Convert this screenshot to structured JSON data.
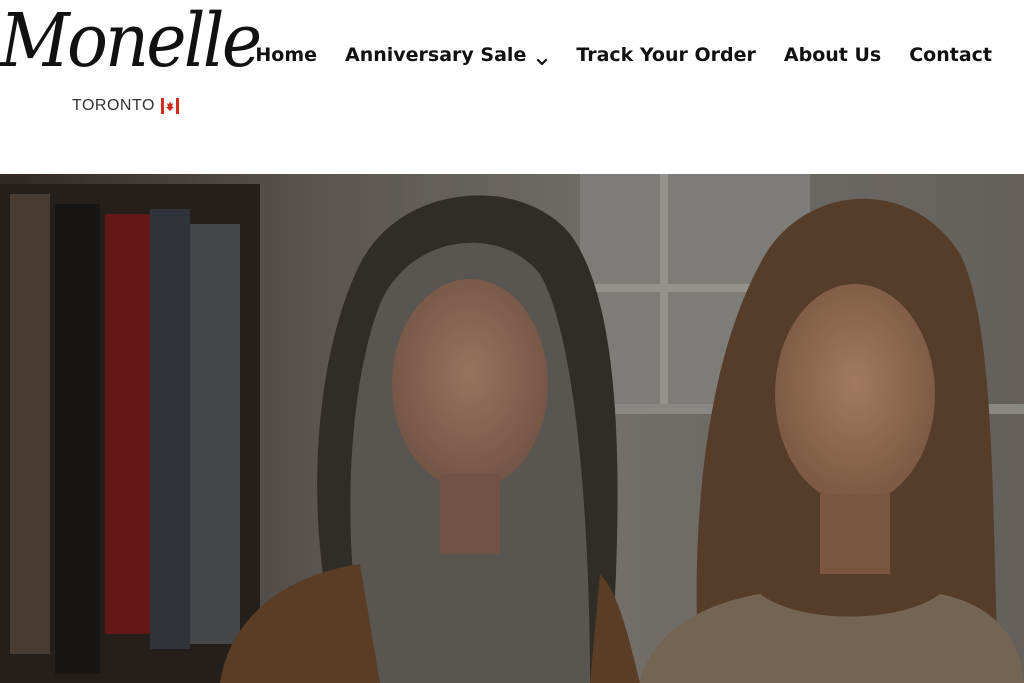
{
  "brand": {
    "name": "Monelle",
    "city": "TORONTO",
    "flag_icon": "canada-flag-icon"
  },
  "nav": {
    "items": [
      {
        "label": "Home"
      },
      {
        "label": "Anniversary Sale",
        "has_dropdown": true
      },
      {
        "label": "Track Your Order"
      },
      {
        "label": "About Us"
      },
      {
        "label": "Contact"
      }
    ],
    "dropdown_icon": "chevron-down-icon"
  },
  "hero": {
    "image": "two-women-in-clothing-store-photo"
  },
  "colors": {
    "text": "#111111",
    "flag_red": "#d52b1e"
  }
}
